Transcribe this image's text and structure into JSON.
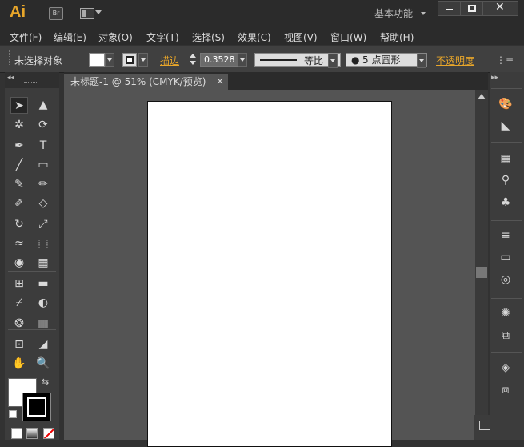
{
  "app": {
    "logo": "Ai",
    "bridge_label": "Br",
    "workspace": "基本功能"
  },
  "menu": [
    "文件(F)",
    "编辑(E)",
    "对象(O)",
    "文字(T)",
    "选择(S)",
    "效果(C)",
    "视图(V)",
    "窗口(W)",
    "帮助(H)"
  ],
  "control": {
    "selection": "未选择对象",
    "stroke_label": "描边",
    "stroke_weight": "0.3528",
    "stroke_profile": "等比",
    "brush": "5 点圆形",
    "opacity_label": "不透明度"
  },
  "document": {
    "tab_title": "未标题-1 @ 51% (CMYK/预览)",
    "close_glyph": "×"
  },
  "tools": [
    {
      "name": "selection-tool-icon",
      "glyph": "➤"
    },
    {
      "name": "direct-selection-tool-icon",
      "glyph": "▲"
    },
    {
      "name": "magic-wand-tool-icon",
      "glyph": "✲"
    },
    {
      "name": "lasso-tool-icon",
      "glyph": "⟳"
    },
    {
      "name": "pen-tool-icon",
      "glyph": "✒"
    },
    {
      "name": "type-tool-icon",
      "glyph": "T"
    },
    {
      "name": "line-tool-icon",
      "glyph": "╱"
    },
    {
      "name": "rectangle-tool-icon",
      "glyph": "▭"
    },
    {
      "name": "paintbrush-tool-icon",
      "glyph": "✎"
    },
    {
      "name": "pencil-tool-icon",
      "glyph": "✏"
    },
    {
      "name": "blob-brush-tool-icon",
      "glyph": "✐"
    },
    {
      "name": "eraser-tool-icon",
      "glyph": "◇"
    },
    {
      "name": "rotate-tool-icon",
      "glyph": "↻"
    },
    {
      "name": "scale-tool-icon",
      "glyph": "⤢"
    },
    {
      "name": "width-tool-icon",
      "glyph": "≈"
    },
    {
      "name": "free-transform-tool-icon",
      "glyph": "⬚"
    },
    {
      "name": "shape-builder-tool-icon",
      "glyph": "◉"
    },
    {
      "name": "perspective-grid-tool-icon",
      "glyph": "▦"
    },
    {
      "name": "mesh-tool-icon",
      "glyph": "⊞"
    },
    {
      "name": "gradient-tool-icon",
      "glyph": "▬"
    },
    {
      "name": "eyedropper-tool-icon",
      "glyph": "⌿"
    },
    {
      "name": "blend-tool-icon",
      "glyph": "◐"
    },
    {
      "name": "symbol-sprayer-tool-icon",
      "glyph": "❂"
    },
    {
      "name": "column-graph-tool-icon",
      "glyph": "▥"
    },
    {
      "name": "artboard-tool-icon",
      "glyph": "⊡"
    },
    {
      "name": "slice-tool-icon",
      "glyph": "◢"
    },
    {
      "name": "hand-tool-icon",
      "glyph": "✋"
    },
    {
      "name": "zoom-tool-icon",
      "glyph": "🔍"
    }
  ],
  "right_icons": [
    {
      "name": "color-panel-icon",
      "glyph": "🎨"
    },
    {
      "name": "color-guide-panel-icon",
      "glyph": "◣"
    },
    {
      "name": "swatches-panel-icon",
      "glyph": "▦"
    },
    {
      "name": "brushes-panel-icon",
      "glyph": "⚲"
    },
    {
      "name": "symbols-panel-icon",
      "glyph": "♣"
    },
    {
      "name": "stroke-panel-icon",
      "glyph": "≡"
    },
    {
      "name": "gradient-panel-icon",
      "glyph": "▭"
    },
    {
      "name": "transparency-panel-icon",
      "glyph": "◎"
    },
    {
      "name": "appearance-panel-icon",
      "glyph": "✺"
    },
    {
      "name": "graphic-styles-panel-icon",
      "glyph": "⧉"
    },
    {
      "name": "layers-panel-icon",
      "glyph": "◈"
    },
    {
      "name": "artboards-panel-icon",
      "glyph": "⧈"
    }
  ]
}
